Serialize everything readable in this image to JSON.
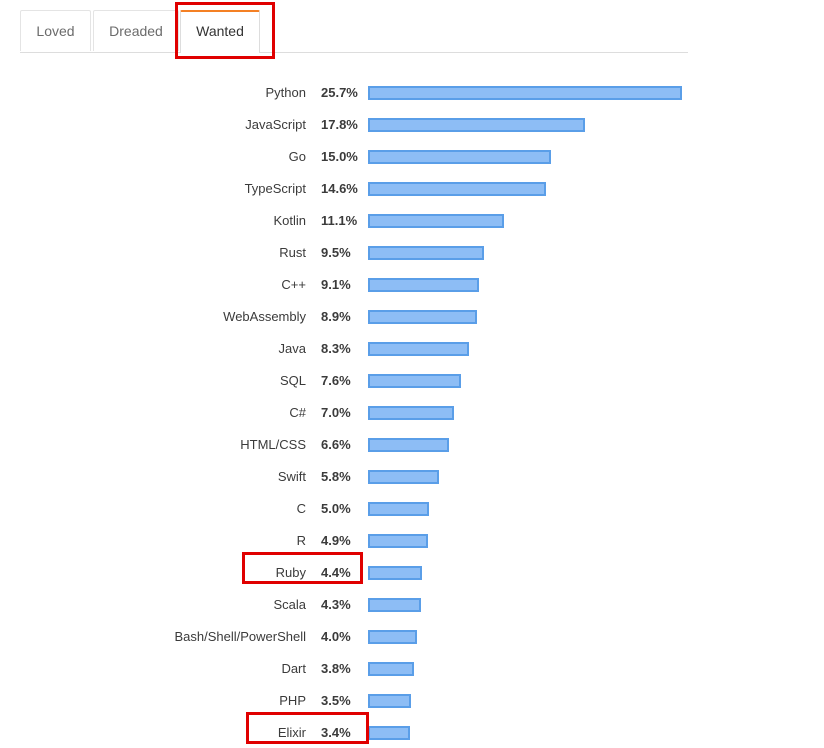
{
  "tabs": [
    {
      "label": "Loved",
      "active": false
    },
    {
      "label": "Dreaded",
      "active": false
    },
    {
      "label": "Wanted",
      "active": true
    }
  ],
  "colors": {
    "bar_fill": "#8dbdf5",
    "bar_border": "#5a9ee8",
    "active_tab_accent": "#f48024",
    "highlight": "#e00000"
  },
  "chart_data": {
    "type": "bar",
    "orientation": "horizontal",
    "title": "",
    "xlabel": "",
    "ylabel": "",
    "xlim": [
      0,
      25.7
    ],
    "value_suffix": "%",
    "categories": [
      "Python",
      "JavaScript",
      "Go",
      "TypeScript",
      "Kotlin",
      "Rust",
      "C++",
      "WebAssembly",
      "Java",
      "SQL",
      "C#",
      "HTML/CSS",
      "Swift",
      "C",
      "R",
      "Ruby",
      "Scala",
      "Bash/Shell/PowerShell",
      "Dart",
      "PHP",
      "Elixir"
    ],
    "values": [
      25.7,
      17.8,
      15.0,
      14.6,
      11.1,
      9.5,
      9.1,
      8.9,
      8.3,
      7.6,
      7.0,
      6.6,
      5.8,
      5.0,
      4.9,
      4.4,
      4.3,
      4.0,
      3.8,
      3.5,
      3.4
    ],
    "labels": [
      "25.7%",
      "17.8%",
      "15.0%",
      "14.6%",
      "11.1%",
      "9.5%",
      "9.1%",
      "8.9%",
      "8.3%",
      "7.6%",
      "7.0%",
      "6.6%",
      "5.8%",
      "5.0%",
      "4.9%",
      "4.4%",
      "4.3%",
      "4.0%",
      "3.8%",
      "3.5%",
      "3.4%"
    ],
    "highlighted": [
      "Ruby",
      "Elixir"
    ]
  }
}
